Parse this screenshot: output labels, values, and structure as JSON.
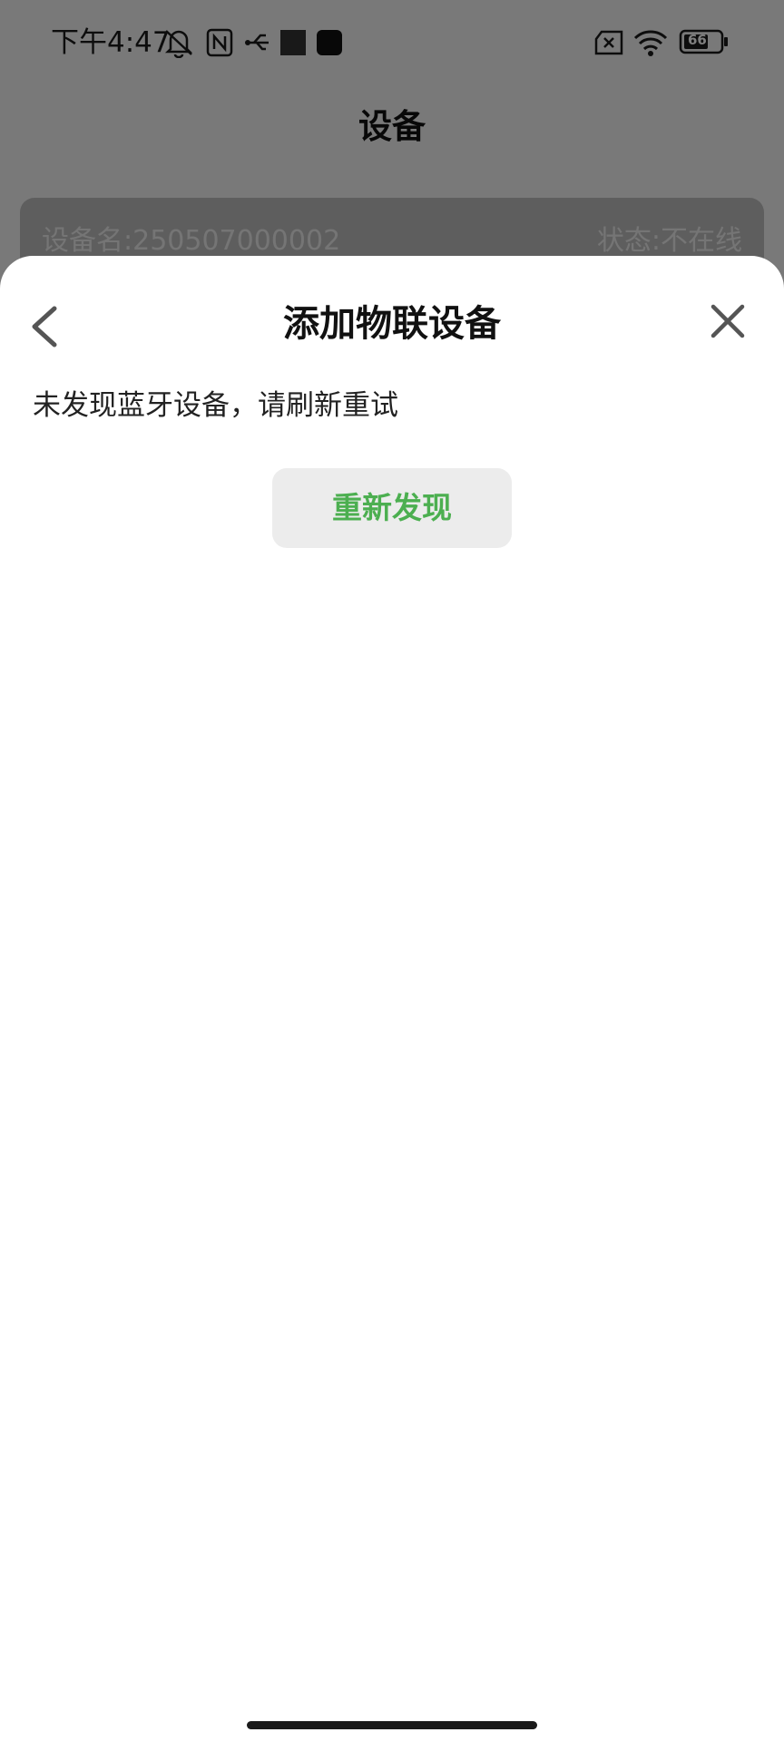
{
  "status_bar": {
    "time": "下午4:47",
    "battery_level": "66",
    "icons": [
      "mute-icon",
      "nfc-icon",
      "usb-icon",
      "app-square-icon",
      "app-rounded-icon",
      "no-sim-icon",
      "wifi-icon",
      "battery-icon"
    ]
  },
  "page": {
    "title": "设备",
    "device_card": {
      "name": "设备名:250507000002",
      "status": "状态:不在线"
    }
  },
  "sheet": {
    "title": "添加物联设备",
    "message": "未发现蓝牙设备，请刷新重试",
    "rediscover_label": "重新发现",
    "back_icon": "chevron-left-icon",
    "close_icon": "close-icon"
  },
  "colors": {
    "accent_green": "#4caf50",
    "sheet_background": "#ffffff",
    "overlay": "rgba(0,0,0,0.5)"
  }
}
